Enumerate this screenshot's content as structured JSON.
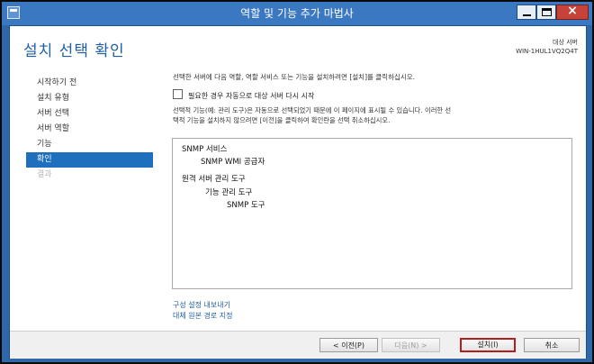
{
  "window": {
    "title": "역할 및 기능 추가 마법사"
  },
  "page": {
    "title": "설치 선택 확인",
    "destination_label": "대상 서버",
    "destination_server": "WIN-1HUL1VQ2Q4T"
  },
  "sidebar": {
    "items": [
      {
        "label": "시작하기 전"
      },
      {
        "label": "설치 유형"
      },
      {
        "label": "서버 선택"
      },
      {
        "label": "서버 역할"
      },
      {
        "label": "기능"
      },
      {
        "label": "확인"
      },
      {
        "label": "결과"
      }
    ]
  },
  "main": {
    "intro": "선택한 서버에 다음 역할, 역할 서비스 또는 기능을 설치하려면 [설치]를 클릭하십시오.",
    "restart_label": "필요한 경우 자동으로 대상 서버 다시 시작",
    "note_line1": "선택적 기능(예: 관리 도구)은 자동으로 선택되었기 때문에 이 페이지에 표시될 수 있습니다. 이러한 선",
    "note_line2": "택적 기능을 설치하지 않으려면 [이전]을 클릭하여 확인란을 선택 취소하십시오.",
    "features": [
      {
        "label": "SNMP 서비스"
      },
      {
        "label": "SNMP WMI 공급자"
      },
      {
        "label": "원격 서버 관리 도구"
      },
      {
        "label": "기능 관리 도구"
      },
      {
        "label": "SNMP 도구"
      }
    ],
    "export_link": "구성 설정 내보내기",
    "alt_source_link": "대체 원본 경로 지정"
  },
  "footer": {
    "prev_label": "< 이전(P)",
    "next_label": "다음(N) >",
    "install_label": "설치(I)",
    "cancel_label": "취소"
  },
  "colors": {
    "title_bar": "#3a78c2",
    "accent": "#1f6fbf",
    "close_button": "#c7433a",
    "install_highlight": "#b01e1e"
  }
}
